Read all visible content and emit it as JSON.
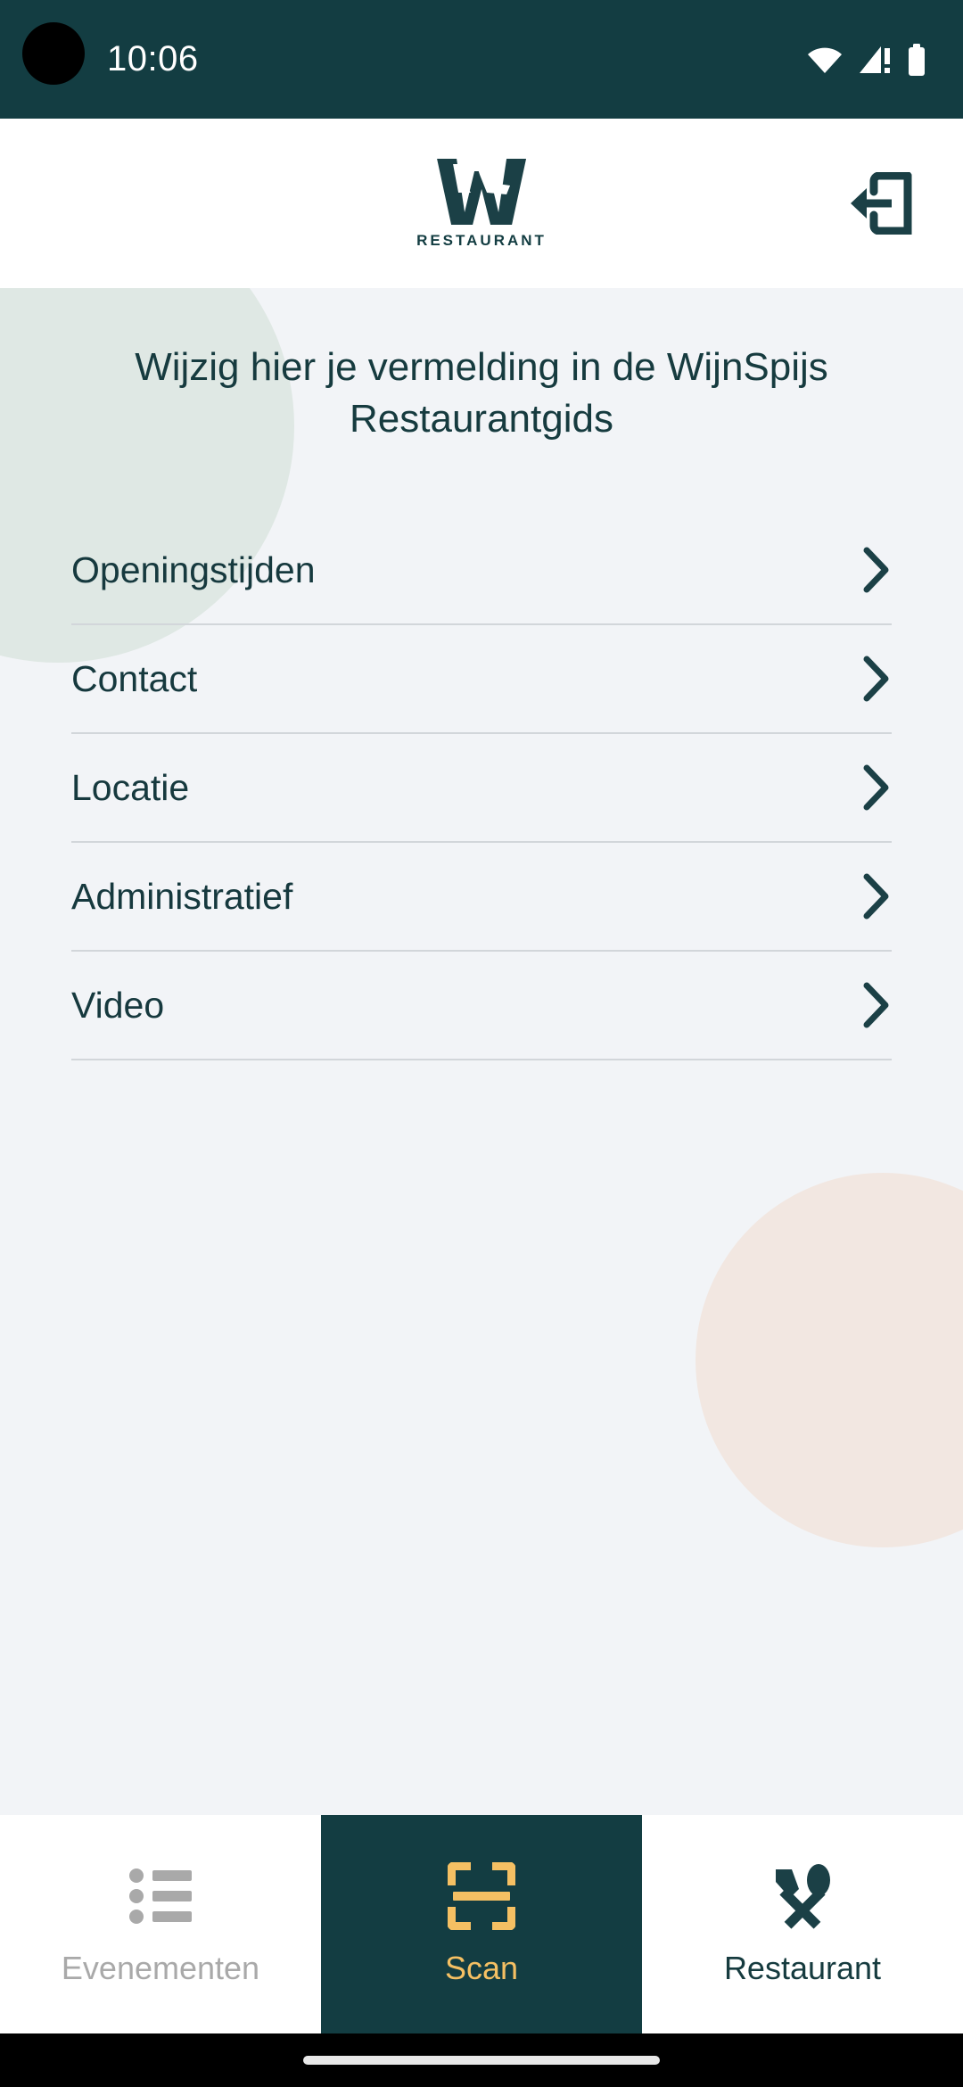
{
  "statusbar": {
    "time": "10:06",
    "icons": [
      "wifi-icon",
      "cellular-signal-icon",
      "battery-icon"
    ]
  },
  "header": {
    "logo_mark": "wijnspijs-w-logo",
    "logo_word": "RESTAURANT",
    "logout_icon": "logout-icon"
  },
  "main": {
    "title": "Wijzig hier je vermelding in de WijnSpijs Restaurantgids",
    "menu": [
      {
        "label": "Openingstijden",
        "chevron": "chevron-right-icon"
      },
      {
        "label": "Contact",
        "chevron": "chevron-right-icon"
      },
      {
        "label": "Locatie",
        "chevron": "chevron-right-icon"
      },
      {
        "label": "Administratief",
        "chevron": "chevron-right-icon"
      },
      {
        "label": "Video",
        "chevron": "chevron-right-icon"
      }
    ]
  },
  "bottomnav": {
    "items": [
      {
        "label": "Evenementen",
        "icon": "bulleted-list-icon",
        "state": "inactive"
      },
      {
        "label": "Scan",
        "icon": "qr-scan-icon",
        "state": "active"
      },
      {
        "label": "Restaurant",
        "icon": "knife-spoon-icon",
        "state": "normal"
      }
    ]
  },
  "colors": {
    "brand_dark_teal": "#133d42",
    "page_background": "#f2f4f7",
    "accent_yellow": "#f5c063",
    "blob_green": "#dfe8e4",
    "blob_beige": "#f2e7e1",
    "divider": "#d2d6da",
    "inactive_gray": "#a9a9a9"
  }
}
